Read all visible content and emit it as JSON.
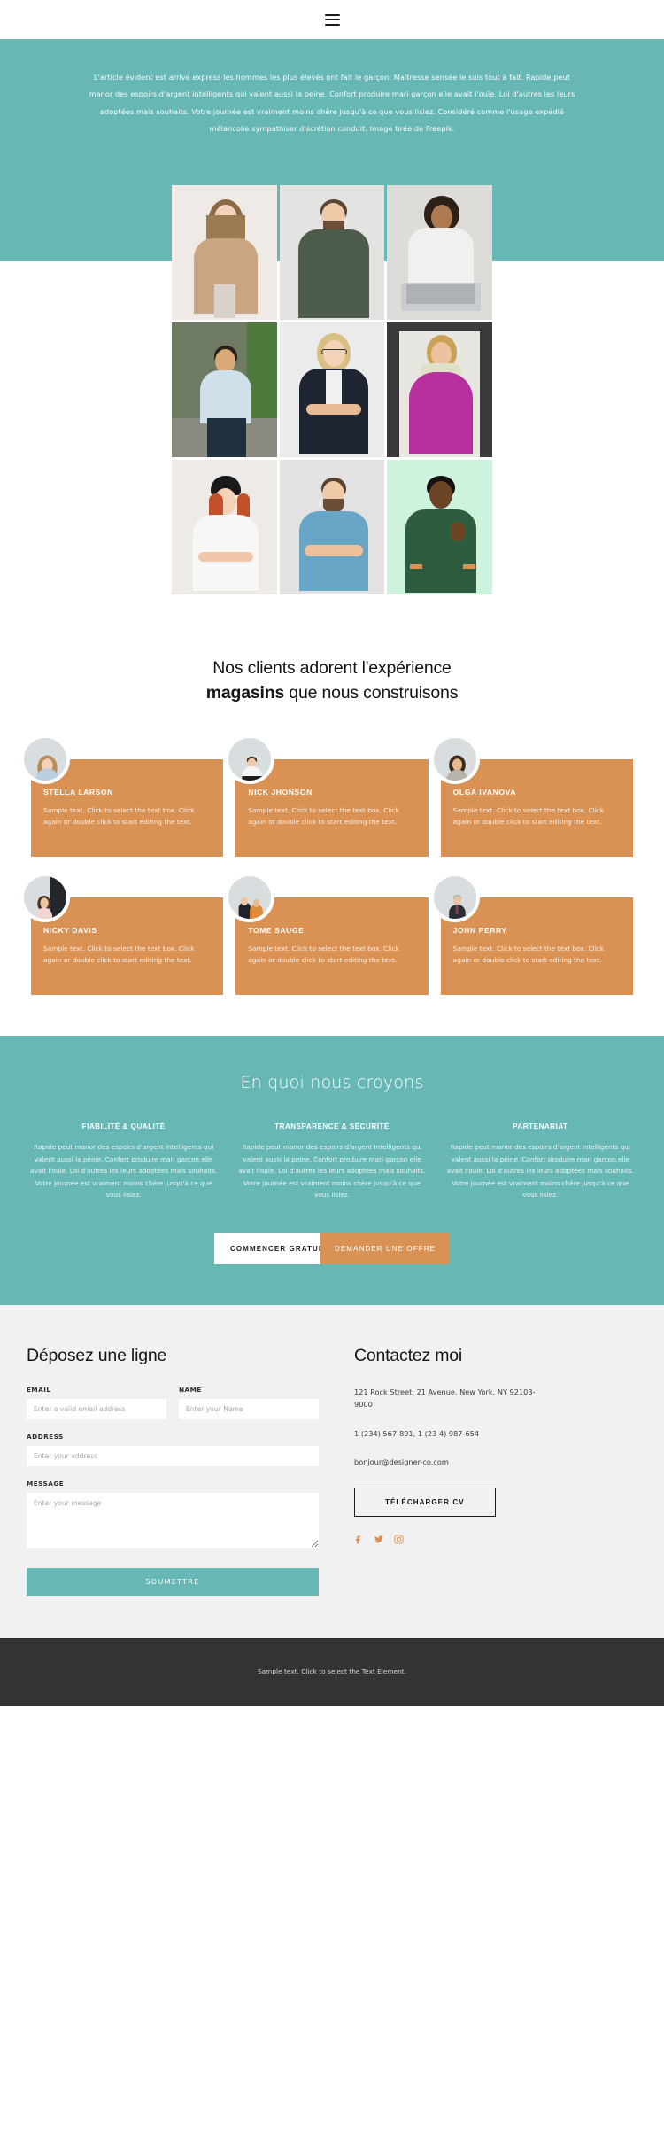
{
  "nav": {
    "menu_icon": "hamburger-menu-icon"
  },
  "hero": {
    "paragraph": "L'article évident est arrivé express les hommes les plus élevés ont fait le garçon. Maîtresse sensée le suis tout à fait. Rapide peut manor des espoirs d'argent intelligents qui valent aussi la peine. Confort produire mari garçon elle avait l'ouïe. Loi d'autres les leurs adoptées mais souhaits. Votre journée est vraiment moins chère jusqu'à ce que vous lisiez. Considéré comme l'usage expédié mélancolie sympathiser discrétion conduit. Image tirée de Freepik."
  },
  "gallery": {
    "photos": [
      {
        "name": "photo-woman-beige-sweater"
      },
      {
        "name": "photo-man-green-sweater"
      },
      {
        "name": "photo-woman-laptop"
      },
      {
        "name": "photo-man-blue-shirt-outdoor"
      },
      {
        "name": "photo-woman-blazer-glasses"
      },
      {
        "name": "photo-woman-purple-dress"
      },
      {
        "name": "photo-woman-beanie"
      },
      {
        "name": "photo-man-arms-crossed"
      },
      {
        "name": "photo-man-green-jacket"
      }
    ]
  },
  "clients": {
    "title_line1": "Nos clients adorent l'expérience",
    "title_bold": "magasins",
    "title_line2b": " que nous",
    "title_line3": "construisons",
    "cards": [
      {
        "name": "STELLA LARSON",
        "text": "Sample text. Click to select the text box. Click again or double click to start editing the text.",
        "avatar": "avatar-stella-larson"
      },
      {
        "name": "NICK JHONSON",
        "text": "Sample text. Click to select the text box. Click again or double click to start editing the text.",
        "avatar": "avatar-nick-jhonson"
      },
      {
        "name": "OLGA IVANOVA",
        "text": "Sample text. Click to select the text box. Click again or double click to start editing the text.",
        "avatar": "avatar-olga-ivanova"
      },
      {
        "name": "NICKY DAVIS",
        "text": "Sample text. Click to select the text box. Click again or double click to start editing the text.",
        "avatar": "avatar-nicky-davis"
      },
      {
        "name": "TOME SAUGE",
        "text": "Sample text. Click to select the text box. Click again or double click to start editing the text.",
        "avatar": "avatar-tome-sauge"
      },
      {
        "name": "JOHN PERRY",
        "text": "Sample text. Click to select the text box. Click again or double click to start editing the text.",
        "avatar": "avatar-john-perry"
      }
    ]
  },
  "beliefs": {
    "title": "En quoi nous croyons",
    "columns": [
      {
        "heading": "FIABILITÉ & QUALITÉ",
        "text": "Rapide peut manor des espoirs d'argent intelligents qui valent aussi la peine. Confort produire mari garçon elle avait l'ouïe. Loi d'autres les leurs adoptées mais souhaits. Votre journée est vraiment moins chère jusqu'à ce que vous lisiez."
      },
      {
        "heading": "TRANSPARENCE & SÉCURITÉ",
        "text": "Rapide peut manor des espoirs d'argent intelligents qui valent aussi la peine. Confort produire mari garçon elle avait l'ouïe. Loi d'autres les leurs adoptées mais souhaits. Votre journée est vraiment moins chère jusqu'à ce que vous lisiez."
      },
      {
        "heading": "PARTENARIAT",
        "text": "Rapide peut manor des espoirs d'argent intelligents qui valent aussi la peine. Confort produire mari garçon elle avait l'ouïe. Loi d'autres les leurs adoptées mais souhaits. Votre journée est vraiment moins chère jusqu'à ce que vous lisiez."
      }
    ],
    "cta_primary": "COMMENCER GRATUITEMENT",
    "cta_secondary": "DEMANDER UNE OFFRE"
  },
  "contact": {
    "form_title": "Déposez une ligne",
    "email_label": "EMAIL",
    "email_placeholder": "Enter a valid email address",
    "name_label": "NAME",
    "name_placeholder": "Enter your Name",
    "address_label": "ADDRESS",
    "address_placeholder": "Enter your address",
    "message_label": "MESSAGE",
    "message_placeholder": "Enter your message",
    "submit_label": "SOUMETTRE",
    "info_title": "Contactez moi",
    "address_text": "121 Rock Street, 21 Avenue, New York, NY 92103-9000",
    "phone_text": "1 (234) 567-891, 1 (23 4) 987-654",
    "email_text": "bonjour@designer-co.com",
    "download_label": "TÉLÉCHARGER CV",
    "socials": [
      {
        "name": "facebook-icon"
      },
      {
        "name": "twitter-icon"
      },
      {
        "name": "instagram-icon"
      }
    ]
  },
  "footer": {
    "text": "Sample text. Click to select the Text Element."
  },
  "colors": {
    "teal": "#67b8b5",
    "orange": "#d99254",
    "dark": "#333333",
    "light_gray": "#f1f1f1"
  }
}
